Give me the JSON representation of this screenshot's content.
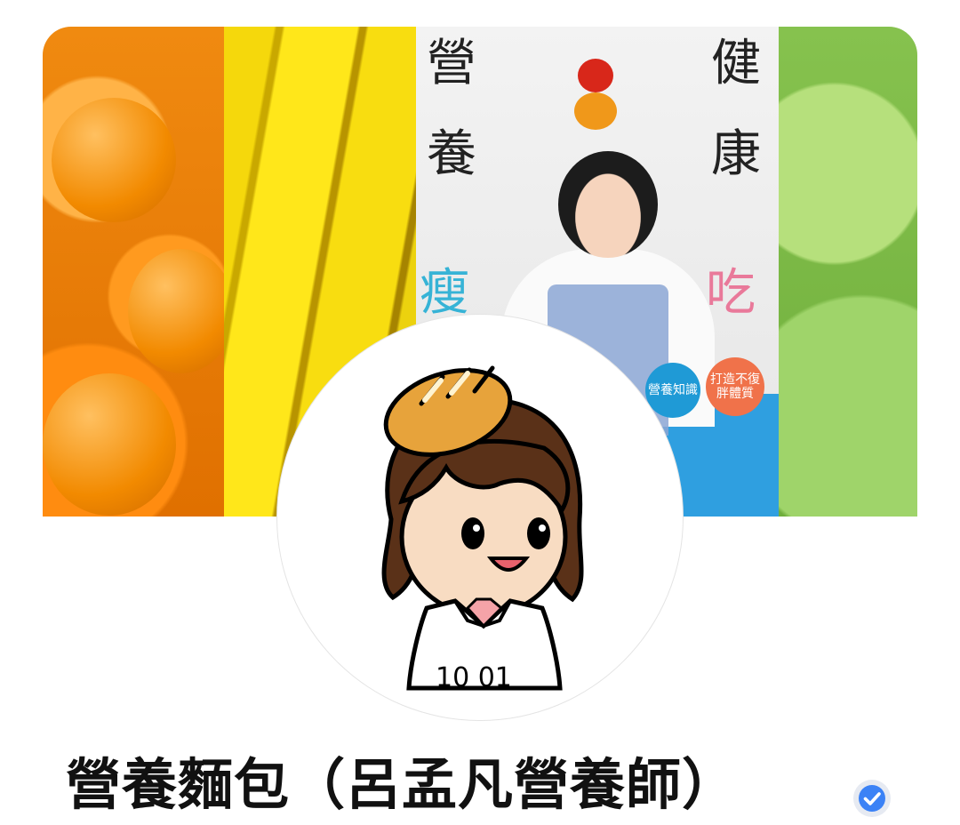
{
  "profile": {
    "name": "營養麵包（呂孟凡營養師）",
    "verified": true,
    "verified_icon": "verified-badge-icon"
  },
  "cover": {
    "book": {
      "title_left": [
        "營",
        "養"
      ],
      "title_right": [
        "健",
        "康"
      ],
      "accent_left": "瘦",
      "accent_right": "吃",
      "badge_blue": "營養知識",
      "badge_orange": "打造不復胖體質"
    }
  },
  "colors": {
    "verified_blue": "#3b82f6",
    "text": "#111111"
  }
}
